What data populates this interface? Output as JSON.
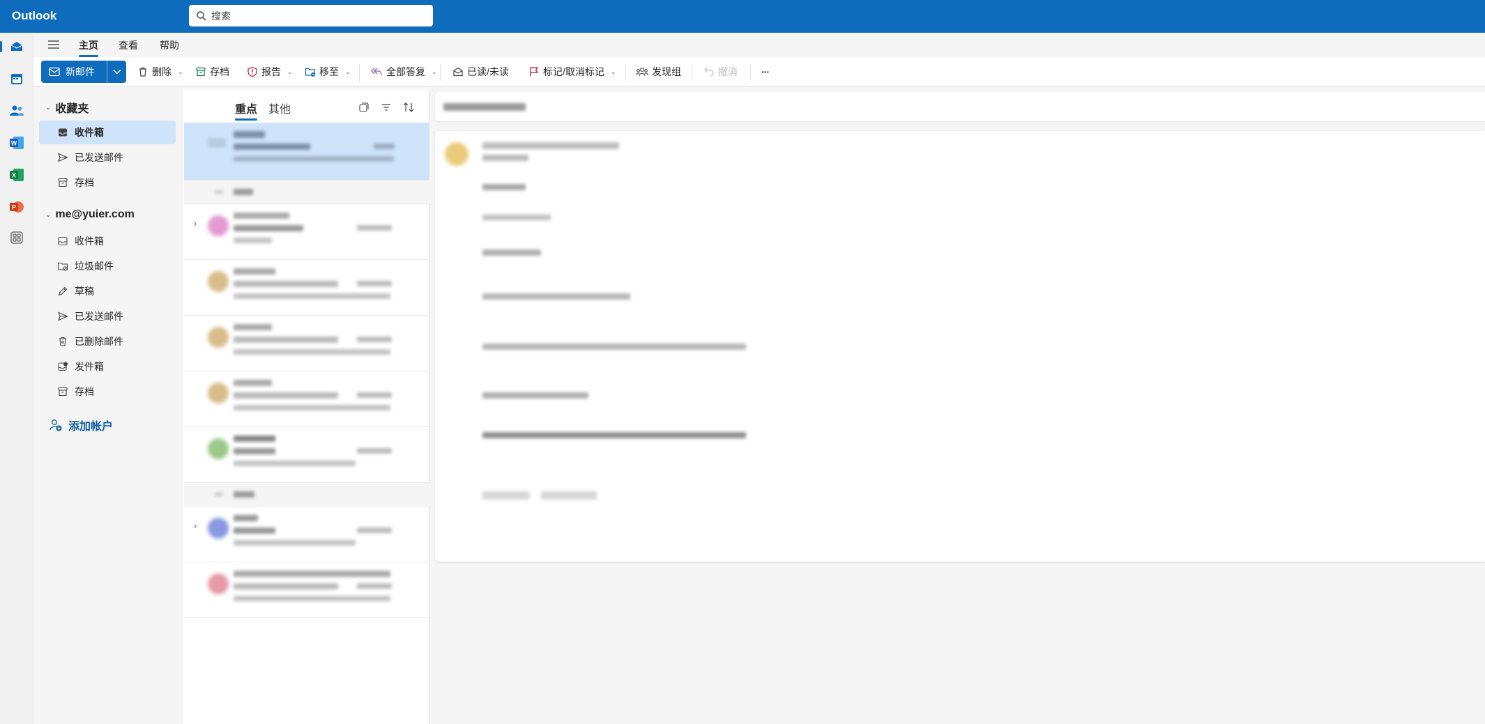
{
  "app": {
    "title": "Outlook"
  },
  "search": {
    "placeholder": "搜索"
  },
  "rail": {
    "items": [
      {
        "name": "mail",
        "icon": "mail-icon"
      },
      {
        "name": "calendar",
        "icon": "calendar-icon"
      },
      {
        "name": "people",
        "icon": "people-icon"
      },
      {
        "name": "word",
        "icon": "word-icon"
      },
      {
        "name": "excel",
        "icon": "excel-icon"
      },
      {
        "name": "powerpoint",
        "icon": "powerpoint-icon"
      },
      {
        "name": "apps",
        "icon": "apps-icon"
      }
    ]
  },
  "ribbon_tabs": {
    "home": "主页",
    "view": "查看",
    "help": "帮助"
  },
  "toolbar": {
    "new_mail": "新邮件",
    "delete": "删除",
    "archive": "存档",
    "report": "报告",
    "move_to": "移至",
    "reply_all": "全部答复",
    "read_unread": "已读/未读",
    "flag": "标记/取消标记",
    "discover_groups": "发现组",
    "undo": "撤消",
    "more": "···"
  },
  "folders": {
    "favorites": {
      "label": "收藏夹",
      "items": [
        "收件箱",
        "已发送邮件",
        "存档"
      ]
    },
    "account": {
      "label": "me@yuier.com",
      "items": [
        "收件箱",
        "垃圾邮件",
        "草稿",
        "已发送邮件",
        "已删除邮件",
        "发件箱",
        "存档"
      ]
    },
    "add_account": "添加帐户"
  },
  "message_list": {
    "tabs": {
      "focused": "重点",
      "other": "其他"
    }
  },
  "colors": {
    "brand": "#0f6cbd",
    "selected": "#cfe4fa",
    "word": "#185abd",
    "excel": "#107c41",
    "powerpoint": "#c43e1c"
  }
}
